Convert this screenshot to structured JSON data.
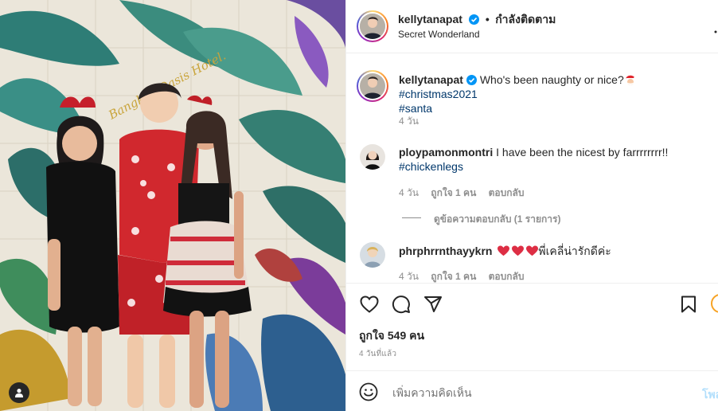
{
  "post": {
    "author": "kellytanapat",
    "follow_label": "กำลังติดตาม",
    "location": "Secret Wonderland"
  },
  "photo": {
    "sign_text": "Bangkok Oasis Hotel.",
    "tag_icon": "person-icon"
  },
  "caption": {
    "author": "kellytanapat",
    "text": "Who's been naughty or nice?",
    "emoji": "santa-emoji",
    "hashtag1": "#christmas2021",
    "hashtag2": "#santa",
    "time": "4 วัน"
  },
  "comments": [
    {
      "author": "ploypamonmontri",
      "text": "I have been the nicest by farrrrrrrr!!",
      "hashtag": "#chickenlegs",
      "time": "4 วัน",
      "likes": "ถูกใจ 1 คน",
      "reply_label": "ตอบกลับ",
      "view_replies": "ดูข้อความตอบกลับ (1 รายการ)"
    },
    {
      "author": "phrphrrnthayykrn",
      "text": "พี่เคลี่น่ารักดีค่ะ",
      "hearts": [
        "red-heart-emoji",
        "red-heart-emoji",
        "red-heart-emoji"
      ],
      "time": "4 วัน",
      "likes": "ถูกใจ 1 คน",
      "reply_label": "ตอบกลับ"
    }
  ],
  "actions": {
    "icons": [
      "heart-icon",
      "comment-icon",
      "share-icon",
      "bookmark-icon"
    ],
    "likes_label": "ถูกใจ 549 คน",
    "age_label": "4 วันที่แล้ว"
  },
  "composer": {
    "placeholder": "เพิ่มความคิดเห็น",
    "post_label": "โพสต์"
  },
  "colors": {
    "verified": "#0095f6",
    "link": "#00376b",
    "muted": "#8e8e8e",
    "heart": "#ed4956"
  }
}
